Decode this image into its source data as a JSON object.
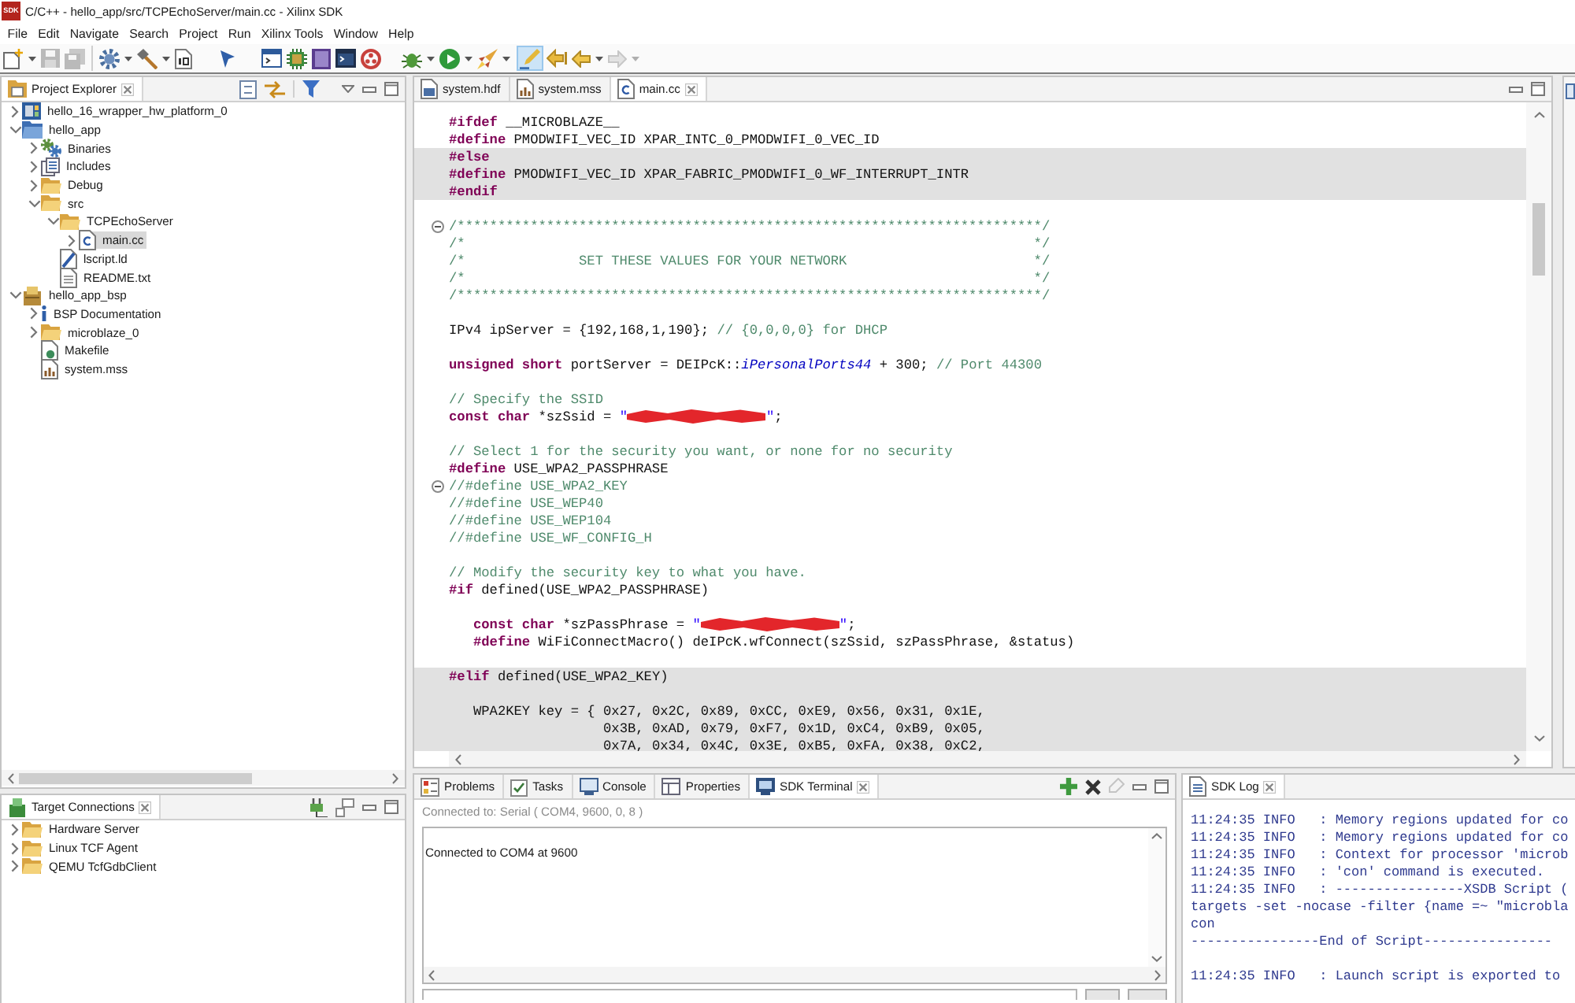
{
  "window": {
    "logo": "SDK",
    "title": "C/C++ - hello_app/src/TCPEchoServer/main.cc - Xilinx SDK"
  },
  "menu": [
    "File",
    "Edit",
    "Navigate",
    "Search",
    "Project",
    "Run",
    "Xilinx Tools",
    "Window",
    "Help"
  ],
  "toolbar": [
    [
      {
        "kind": "new",
        "dropdown": true,
        "disabled": false,
        "pressed": false
      },
      {
        "kind": "save",
        "dropdown": false,
        "disabled": true,
        "pressed": false
      },
      {
        "kind": "saveall",
        "dropdown": false,
        "disabled": true,
        "pressed": false
      }
    ],
    [
      {
        "kind": "config",
        "dropdown": true,
        "disabled": false,
        "pressed": false
      },
      {
        "kind": "hammer",
        "dropdown": true,
        "disabled": false,
        "pressed": false
      },
      {
        "kind": "binary",
        "dropdown": false,
        "disabled": false,
        "pressed": false
      }
    ],
    [
      {
        "kind": "pointer",
        "dropdown": false,
        "disabled": false,
        "pressed": false
      }
    ],
    [
      {
        "kind": "window",
        "dropdown": false,
        "disabled": false,
        "pressed": false
      },
      {
        "kind": "chip",
        "dropdown": false,
        "disabled": false,
        "pressed": false
      },
      {
        "kind": "book",
        "dropdown": false,
        "disabled": false,
        "pressed": false
      },
      {
        "kind": "console",
        "dropdown": false,
        "disabled": false,
        "pressed": false
      },
      {
        "kind": "ring",
        "dropdown": false,
        "disabled": false,
        "pressed": false
      }
    ],
    [
      {
        "kind": "debug",
        "dropdown": true,
        "disabled": false,
        "pressed": false
      },
      {
        "kind": "run",
        "dropdown": true,
        "disabled": false,
        "pressed": false
      },
      {
        "kind": "tools",
        "dropdown": true,
        "disabled": false,
        "pressed": false
      }
    ],
    [
      {
        "kind": "highlighter",
        "dropdown": false,
        "disabled": false,
        "pressed": true
      },
      {
        "kind": "lastedit",
        "dropdown": false,
        "disabled": false,
        "pressed": false
      },
      {
        "kind": "back",
        "dropdown": true,
        "disabled": false,
        "pressed": false
      },
      {
        "kind": "forward",
        "dropdown": true,
        "disabled": true,
        "pressed": false
      }
    ]
  ],
  "project_explorer": {
    "title": "Project Explorer",
    "tree": [
      {
        "label": "hello_16_wrapper_hw_platform_0",
        "kind": "platform",
        "expanded": false,
        "selected": false
      },
      {
        "label": "hello_app",
        "kind": "project",
        "expanded": true,
        "selected": false,
        "children": [
          {
            "label": "Binaries",
            "kind": "binaries",
            "expanded": false,
            "selected": false
          },
          {
            "label": "Includes",
            "kind": "includes",
            "expanded": false,
            "selected": false
          },
          {
            "label": "Debug",
            "kind": "folder",
            "expanded": false,
            "selected": false
          },
          {
            "label": "src",
            "kind": "folder",
            "expanded": true,
            "selected": false,
            "children": [
              {
                "label": "TCPEchoServer",
                "kind": "folder",
                "expanded": true,
                "selected": false,
                "children": [
                  {
                    "label": "main.cc",
                    "kind": "csrc",
                    "expanded": false,
                    "selected": true
                  }
                ]
              },
              {
                "label": "lscript.ld",
                "kind": "linker",
                "selected": false
              },
              {
                "label": "README.txt",
                "kind": "text",
                "selected": false
              }
            ]
          }
        ]
      },
      {
        "label": "hello_app_bsp",
        "kind": "bsp",
        "expanded": true,
        "selected": false,
        "children": [
          {
            "label": "BSP Documentation",
            "kind": "info",
            "expanded": false,
            "selected": false
          },
          {
            "label": "microblaze_0",
            "kind": "folder",
            "expanded": false,
            "selected": false
          },
          {
            "label": "Makefile",
            "kind": "makefile",
            "selected": false
          },
          {
            "label": "system.mss",
            "kind": "mss",
            "selected": false
          }
        ]
      }
    ]
  },
  "target_connections": {
    "title": "Target Connections",
    "tree": [
      {
        "label": "Hardware Server",
        "kind": "folder",
        "expanded": false,
        "selected": false
      },
      {
        "label": "Linux TCF Agent",
        "kind": "folder",
        "expanded": false,
        "selected": false
      },
      {
        "label": "QEMU TcfGdbClient",
        "kind": "folder",
        "expanded": false,
        "selected": false
      }
    ]
  },
  "editor": {
    "tabs": [
      {
        "label": "system.hdf",
        "kind": "hdf",
        "selected": false
      },
      {
        "label": "system.mss",
        "kind": "mss",
        "selected": false
      },
      {
        "label": "main.cc",
        "kind": "csrc",
        "selected": true
      }
    ],
    "lines": [
      {
        "tokens": [
          {
            "kind": "keyword",
            "text": "#ifdef"
          },
          {
            "kind": "plain",
            "text": " __MICROBLAZE__"
          }
        ],
        "inactive": false,
        "fold_marker": false
      },
      {
        "tokens": [
          {
            "kind": "keyword",
            "text": "#define"
          },
          {
            "kind": "plain",
            "text": " PMODWIFI_VEC_ID XPAR_INTC_0_PMODWIFI_0_VEC_ID"
          }
        ],
        "inactive": false,
        "fold_marker": false
      },
      {
        "tokens": [
          {
            "kind": "keyword",
            "text": "#else"
          }
        ],
        "inactive": true,
        "fold_marker": false
      },
      {
        "tokens": [
          {
            "kind": "keyword",
            "text": "#define"
          },
          {
            "kind": "plain",
            "text": " PMODWIFI_VEC_ID XPAR_FABRIC_PMODWIFI_0_WF_INTERRUPT_INTR"
          }
        ],
        "inactive": true,
        "fold_marker": false
      },
      {
        "tokens": [
          {
            "kind": "keyword",
            "text": "#endif"
          }
        ],
        "inactive": true,
        "fold_marker": false
      },
      {
        "inactive": false,
        "fold_marker": false
      },
      {
        "tokens": [
          {
            "kind": "comment",
            "text": "/************************************************************************/"
          }
        ],
        "inactive": false,
        "fold_marker": true
      },
      {
        "tokens": [
          {
            "kind": "comment",
            "text": "/*                                                                      */"
          }
        ],
        "inactive": false,
        "fold_marker": false
      },
      {
        "tokens": [
          {
            "kind": "comment",
            "text": "/*              SET THESE VALUES FOR YOUR NETWORK                       */"
          }
        ],
        "inactive": false,
        "fold_marker": false
      },
      {
        "tokens": [
          {
            "kind": "comment",
            "text": "/*                                                                      */"
          }
        ],
        "inactive": false,
        "fold_marker": false
      },
      {
        "tokens": [
          {
            "kind": "comment",
            "text": "/************************************************************************/"
          }
        ],
        "inactive": false,
        "fold_marker": false
      },
      {
        "inactive": false,
        "fold_marker": false
      },
      {
        "tokens": [
          {
            "kind": "plain",
            "text": "IPv4 ipServer = {192,168,1,190}; "
          },
          {
            "kind": "comment",
            "text": "// {0,0,0,0} for DHCP"
          }
        ],
        "inactive": false,
        "fold_marker": false
      },
      {
        "inactive": false,
        "fold_marker": false
      },
      {
        "tokens": [
          {
            "kind": "keyword",
            "text": "unsigned short"
          },
          {
            "kind": "plain",
            "text": " portServer = DEIPcK::"
          },
          {
            "kind": "field",
            "text": "iPersonalPorts44"
          },
          {
            "kind": "plain",
            "text": " + 300; "
          },
          {
            "kind": "comment",
            "text": "// Port 44300"
          }
        ],
        "inactive": false,
        "fold_marker": false
      },
      {
        "inactive": false,
        "fold_marker": false
      },
      {
        "tokens": [
          {
            "kind": "comment",
            "text": "// Specify the SSID"
          }
        ],
        "inactive": false,
        "fold_marker": false
      },
      {
        "tokens": [
          {
            "kind": "keyword",
            "text": "const char"
          },
          {
            "kind": "plain",
            "text": " *szSsid = "
          },
          {
            "kind": "string",
            "text": "\""
          },
          {
            "kind": "redacted"
          },
          {
            "kind": "string",
            "text": "\""
          },
          {
            "kind": "plain",
            "text": ";"
          }
        ],
        "inactive": false,
        "fold_marker": false
      },
      {
        "inactive": false,
        "fold_marker": false
      },
      {
        "tokens": [
          {
            "kind": "comment",
            "text": "// Select 1 for the security you want, or none for no security"
          }
        ],
        "inactive": false,
        "fold_marker": false
      },
      {
        "tokens": [
          {
            "kind": "keyword",
            "text": "#define"
          },
          {
            "kind": "plain",
            "text": " USE_WPA2_PASSPHRASE"
          }
        ],
        "inactive": false,
        "fold_marker": false
      },
      {
        "tokens": [
          {
            "kind": "comment",
            "text": "//#define USE_WPA2_KEY"
          }
        ],
        "inactive": false,
        "fold_marker": true
      },
      {
        "tokens": [
          {
            "kind": "comment",
            "text": "//#define USE_WEP40"
          }
        ],
        "inactive": false,
        "fold_marker": false
      },
      {
        "tokens": [
          {
            "kind": "comment",
            "text": "//#define USE_WEP104"
          }
        ],
        "inactive": false,
        "fold_marker": false
      },
      {
        "tokens": [
          {
            "kind": "comment",
            "text": "//#define USE_WF_CONFIG_H"
          }
        ],
        "inactive": false,
        "fold_marker": false
      },
      {
        "inactive": false,
        "fold_marker": false
      },
      {
        "tokens": [
          {
            "kind": "comment",
            "text": "// Modify the security key to what you have."
          }
        ],
        "inactive": false,
        "fold_marker": false
      },
      {
        "tokens": [
          {
            "kind": "keyword",
            "text": "#if"
          },
          {
            "kind": "plain",
            "text": " defined(USE_WPA2_PASSPHRASE)"
          }
        ],
        "inactive": false,
        "fold_marker": false
      },
      {
        "inactive": false,
        "fold_marker": false
      },
      {
        "tokens": [
          {
            "kind": "keyword",
            "text": "   const char"
          },
          {
            "kind": "plain",
            "text": " *szPassPhrase = "
          },
          {
            "kind": "string",
            "text": "\""
          },
          {
            "kind": "redacted"
          },
          {
            "kind": "string",
            "text": "\""
          },
          {
            "kind": "plain",
            "text": ";"
          }
        ],
        "inactive": false,
        "fold_marker": false
      },
      {
        "tokens": [
          {
            "kind": "keyword",
            "text": "   #define"
          },
          {
            "kind": "plain",
            "text": " WiFiConnectMacro() deIPcK.wfConnect(szSsid, szPassPhrase, &status)"
          }
        ],
        "inactive": false,
        "fold_marker": false
      },
      {
        "inactive": false,
        "fold_marker": false
      },
      {
        "tokens": [
          {
            "kind": "keyword",
            "text": "#elif"
          },
          {
            "kind": "plain",
            "text": " defined(USE_WPA2_KEY)"
          }
        ],
        "inactive": true,
        "fold_marker": false
      },
      {
        "inactive": true,
        "fold_marker": false
      },
      {
        "tokens": [
          {
            "kind": "plain",
            "text": "   WPA2KEY key = { 0x27, 0x2C, 0x89, 0xCC, 0xE9, 0x56, 0x31, 0x1E,"
          }
        ],
        "inactive": true,
        "fold_marker": false
      },
      {
        "tokens": [
          {
            "kind": "plain",
            "text": "                   0x3B, 0xAD, 0x79, 0xF7, 0x1D, 0xC4, 0xB9, 0x05,"
          }
        ],
        "inactive": true,
        "fold_marker": false
      },
      {
        "tokens": [
          {
            "kind": "plain",
            "text": "                   0x7A, 0x34, 0x4C, 0x3E, 0xB5, 0xFA, 0x38, 0xC2,"
          }
        ],
        "inactive": true,
        "fold_marker": false
      }
    ]
  },
  "terminal": {
    "tabs": [
      {
        "label": "Problems",
        "kind": "problems",
        "selected": false
      },
      {
        "label": "Tasks",
        "kind": "tasks",
        "selected": false
      },
      {
        "label": "Console",
        "kind": "console",
        "selected": false
      },
      {
        "label": "Properties",
        "kind": "properties",
        "selected": false
      },
      {
        "label": "SDK Terminal",
        "kind": "terminal",
        "selected": true
      }
    ],
    "status": "Connected to: Serial ( COM4, 9600, 0, 8 )",
    "output": "Connected to COM4 at 9600"
  },
  "sdk_log": {
    "title": "SDK Log",
    "blocks": [
      [
        "11:24:35 INFO   : Memory regions updated for co",
        "11:24:35 INFO   : Memory regions updated for co",
        "11:24:35 INFO   : Context for processor 'microb",
        "11:24:35 INFO   : 'con' command is executed.",
        "11:24:35 INFO   : ----------------XSDB Script (",
        "targets -set -nocase -filter {name =~ \"microbla",
        "con",
        "----------------End of Script----------------"
      ],
      [
        "11:24:35 INFO   : Launch script is exported to"
      ]
    ]
  }
}
